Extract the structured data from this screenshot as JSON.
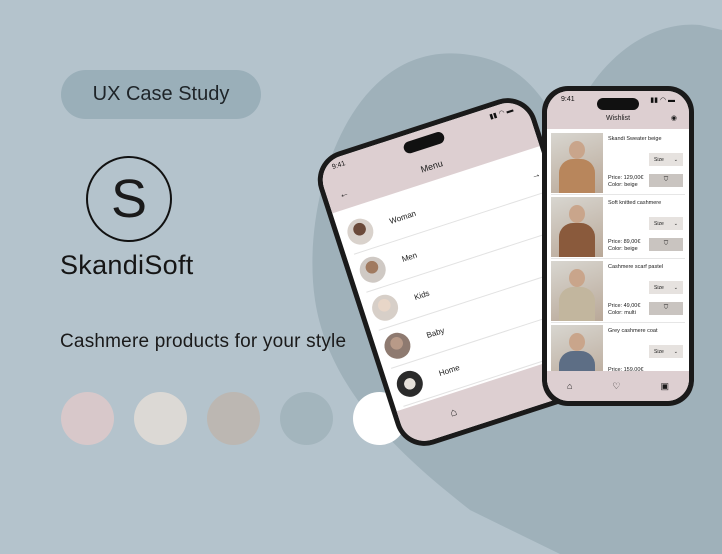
{
  "colors": {
    "background": "#b4c3cc",
    "heart": "#9fb1ba",
    "badge": "#9aafb9",
    "header_pink": "#ddcfd1"
  },
  "badge": {
    "label": "UX Case Study"
  },
  "logo": {
    "letter": "S"
  },
  "brand": {
    "name": "SkandiSoft"
  },
  "tagline": "Cashmere products for your style",
  "swatches": [
    "#d8c8ca",
    "#dcd9d5",
    "#bcb7b2",
    "#a3b5bd",
    "#ffffff"
  ],
  "menu_phone": {
    "time": "9:41",
    "title": "Menu",
    "back_icon": "arrow-left-icon",
    "items": [
      {
        "label": "Woman",
        "icon": "arrow-right-icon"
      },
      {
        "label": "Men",
        "icon": "arrow-right-icon"
      },
      {
        "label": "Kids"
      },
      {
        "label": "Baby"
      },
      {
        "label": "Home"
      }
    ],
    "footer_icons": [
      "home-icon",
      "heart-icon"
    ]
  },
  "wishlist_phone": {
    "time": "9:41",
    "title": "Wishlist",
    "items": [
      {
        "name": "Skandi Sweater beige",
        "price": "Price: 129,00€",
        "color": "Color: beige",
        "size": "Size",
        "sweater": "#b8865c"
      },
      {
        "name": "Soft knitted cashmere",
        "price": "Price: 89,00€",
        "color": "Color: beige",
        "size": "Size",
        "sweater": "#8a5a3c"
      },
      {
        "name": "Cashmere scarf pastel",
        "price": "Price: 49,00€",
        "color": "Color: multi",
        "size": "Size",
        "sweater": "#c2b69e"
      },
      {
        "name": "Grey cashmere coat",
        "price": "Price: 159,00€",
        "color": "",
        "size": "Size",
        "sweater": "#5d6e85"
      }
    ],
    "footer_icons": [
      "home-icon",
      "heart-icon",
      "bag-icon"
    ]
  }
}
